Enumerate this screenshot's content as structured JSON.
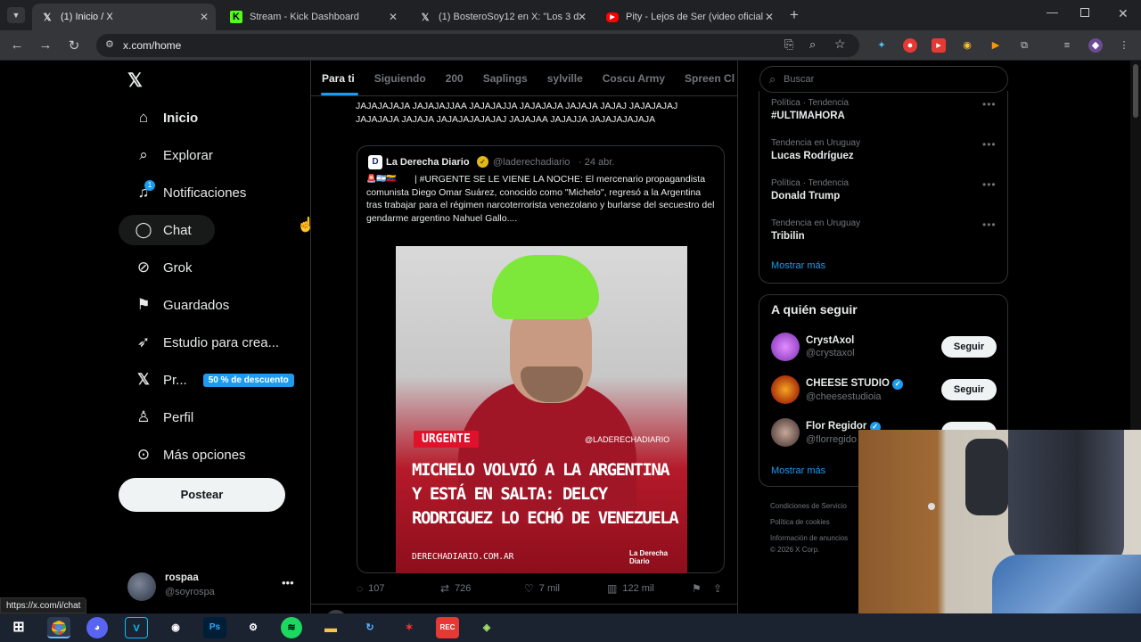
{
  "browser": {
    "tabs": [
      {
        "title": "(1) Inicio / X",
        "favicon": "x-logo-icon",
        "active": true
      },
      {
        "title": "Stream - Kick Dashboard",
        "favicon": "kick-icon",
        "active": false
      },
      {
        "title": "(1) BosteroSoy12 en X: \"Los 3 d",
        "favicon": "x-logo-icon",
        "active": false
      },
      {
        "title": "Pity - Lejos de Ser (video oficial",
        "favicon": "youtube-icon",
        "active": false
      }
    ],
    "url": "x.com/home",
    "status_url": "https://x.com/i/chat"
  },
  "sidebar": {
    "items": [
      {
        "label": "Inicio",
        "icon": "home-icon"
      },
      {
        "label": "Explorar",
        "icon": "search-icon"
      },
      {
        "label": "Notificaciones",
        "icon": "bell-icon",
        "badge": "1"
      },
      {
        "label": "Chat",
        "icon": "chat-icon"
      },
      {
        "label": "Grok",
        "icon": "grok-icon"
      },
      {
        "label": "Guardados",
        "icon": "bookmark-icon"
      },
      {
        "label": "Estudio para crea...",
        "icon": "rocket-icon"
      },
      {
        "label": "Pr...",
        "icon": "x-premium-icon",
        "badge": "50 % de descuento"
      },
      {
        "label": "Perfil",
        "icon": "person-icon"
      },
      {
        "label": "Más opciones",
        "icon": "more-circle-icon"
      }
    ],
    "post_button": "Postear",
    "account": {
      "name": "rospaa",
      "handle": "@soyrospa"
    }
  },
  "feed": {
    "tabs": [
      "Para ti",
      "Siguiendo",
      "200",
      "Saplings",
      "sylville",
      "Coscu Army",
      "Spreen Cl"
    ],
    "post_text": "JAJAJAJAJA JAJAJAJJAA JAJAJAJJA JAJAJAJA JAJAJA JAJAJ JAJAJAJAJ JAJAJAJA JAJAJA JAJAJAJAJAJAJ JAJAJAA JAJAJJA JAJAJAJAJAJA",
    "quote": {
      "author": "La Derecha Diario",
      "handle": "@laderechadiario",
      "date": "· 24 abr.",
      "text": "| #URGENTE SE LE VIENE LA NOCHE: El mercenario propagandista comunista Diego Omar Suárez, conocido como \"Michelo\", regresó a la Argentina tras trabajar para el régimen narcoterrorista venezolano y burlarse del secuestro del gendarme argentino Nahuel Gallo....",
      "image": {
        "tag": "URGENTE",
        "watermark": "@LADERECHADIARIO",
        "headline": "MICHELO VOLVIÓ A LA ARGENTINA Y ESTÁ EN SALTA: DELCY RODRIGUEZ LO ECHÓ DE VENEZUELA",
        "site": "DERECHADIARIO.COM.AR",
        "brand": "La Derecha Diario"
      }
    },
    "stats": {
      "replies": "107",
      "reposts": "726",
      "likes": "7 mil",
      "views": "122 mil"
    }
  },
  "right": {
    "search_placeholder": "Buscar",
    "trends": [
      {
        "category": "Política · Tendencia",
        "name": "#ULTIMAHORA"
      },
      {
        "category": "Tendencia en Uruguay",
        "name": "Lucas Rodríguez"
      },
      {
        "category": "Política · Tendencia",
        "name": "Donald Trump"
      },
      {
        "category": "Tendencia en Uruguay",
        "name": "Tribilin"
      }
    ],
    "show_more": "Mostrar más",
    "who_to_follow_title": "A quién seguir",
    "who_to_follow": [
      {
        "name": "CrystAxol",
        "handle": "@crystaxol",
        "verified": false
      },
      {
        "name": "CHEESE STUDIO",
        "handle": "@cheesestudioia",
        "verified": true
      },
      {
        "name": "Flor Regidor",
        "handle": "@florregido",
        "verified": true
      }
    ],
    "follow_label": "Seguir",
    "footer": [
      "Condiciones de Servicio",
      "Política de cookies",
      "Información de anuncios",
      "© 2026 X Corp."
    ]
  },
  "colors": {
    "accent": "#1d9bf0",
    "urgent": "#e0112b",
    "green_hair": "#7ee83a"
  }
}
